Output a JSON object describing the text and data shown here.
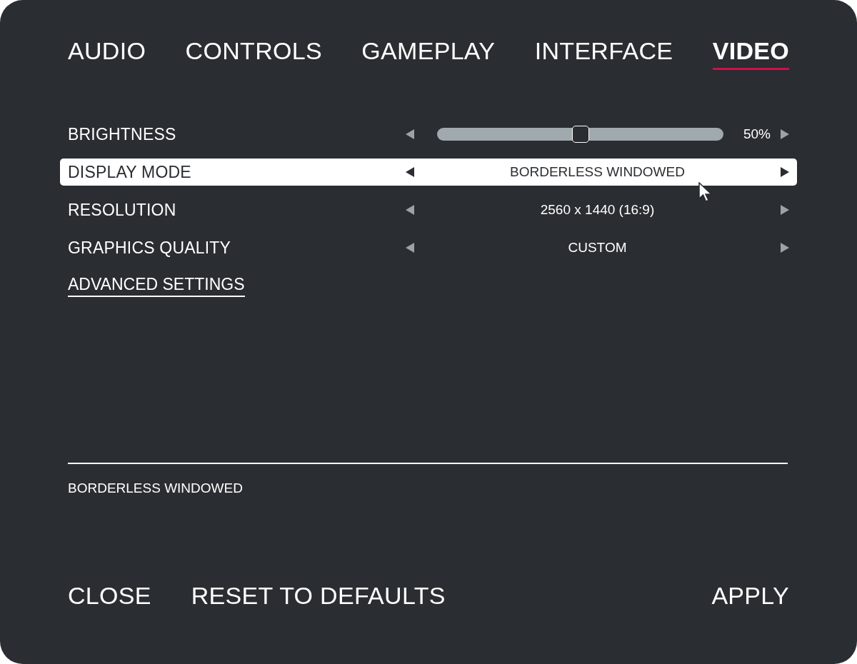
{
  "tabs": [
    {
      "label": "AUDIO",
      "selected": false
    },
    {
      "label": "CONTROLS",
      "selected": false
    },
    {
      "label": "GAMEPLAY",
      "selected": false
    },
    {
      "label": "INTERFACE",
      "selected": false
    },
    {
      "label": "VIDEO",
      "selected": true
    }
  ],
  "settings": [
    {
      "kind": "slider",
      "label": "BRIGHTNESS",
      "level": 0.5,
      "reading": "50%",
      "selected": false
    },
    {
      "kind": "choice",
      "label": "DISPLAY MODE",
      "value": "BORDERLESS WINDOWED",
      "selected": true
    },
    {
      "kind": "choice",
      "label": "RESOLUTION",
      "value": "2560 x 1440 (16:9)",
      "selected": false
    },
    {
      "kind": "choice",
      "label": "GRAPHICS QUALITY",
      "value": "CUSTOM",
      "selected": false
    }
  ],
  "advanced_link": "ADVANCED SETTINGS",
  "description": "BORDERLESS WINDOWED",
  "footer": {
    "left_buttons": [
      "CLOSE",
      "RESET TO DEFAULTS"
    ],
    "right_buttons": [
      "APPLY"
    ]
  }
}
